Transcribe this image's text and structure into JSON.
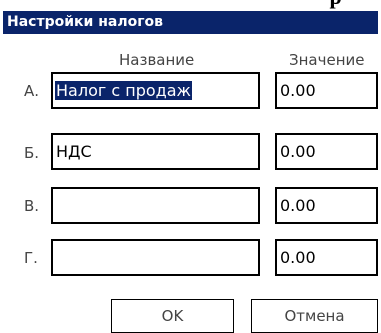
{
  "window": {
    "title": "Настройки налогов"
  },
  "header": {
    "name_col": "Название",
    "value_col": "Значение"
  },
  "rows": [
    {
      "label": "А.",
      "name": "Налог с продаж",
      "value": "0.00"
    },
    {
      "label": "Б.",
      "name": "НДС",
      "value": "0.00"
    },
    {
      "label": "В.",
      "name": "",
      "value": "0.00"
    },
    {
      "label": "Г.",
      "name": "",
      "value": "0.00"
    }
  ],
  "buttons": {
    "ok": "OK",
    "cancel": "Отмена"
  },
  "colors": {
    "titlebar": "#0a246a",
    "selection": "#0a246a"
  }
}
